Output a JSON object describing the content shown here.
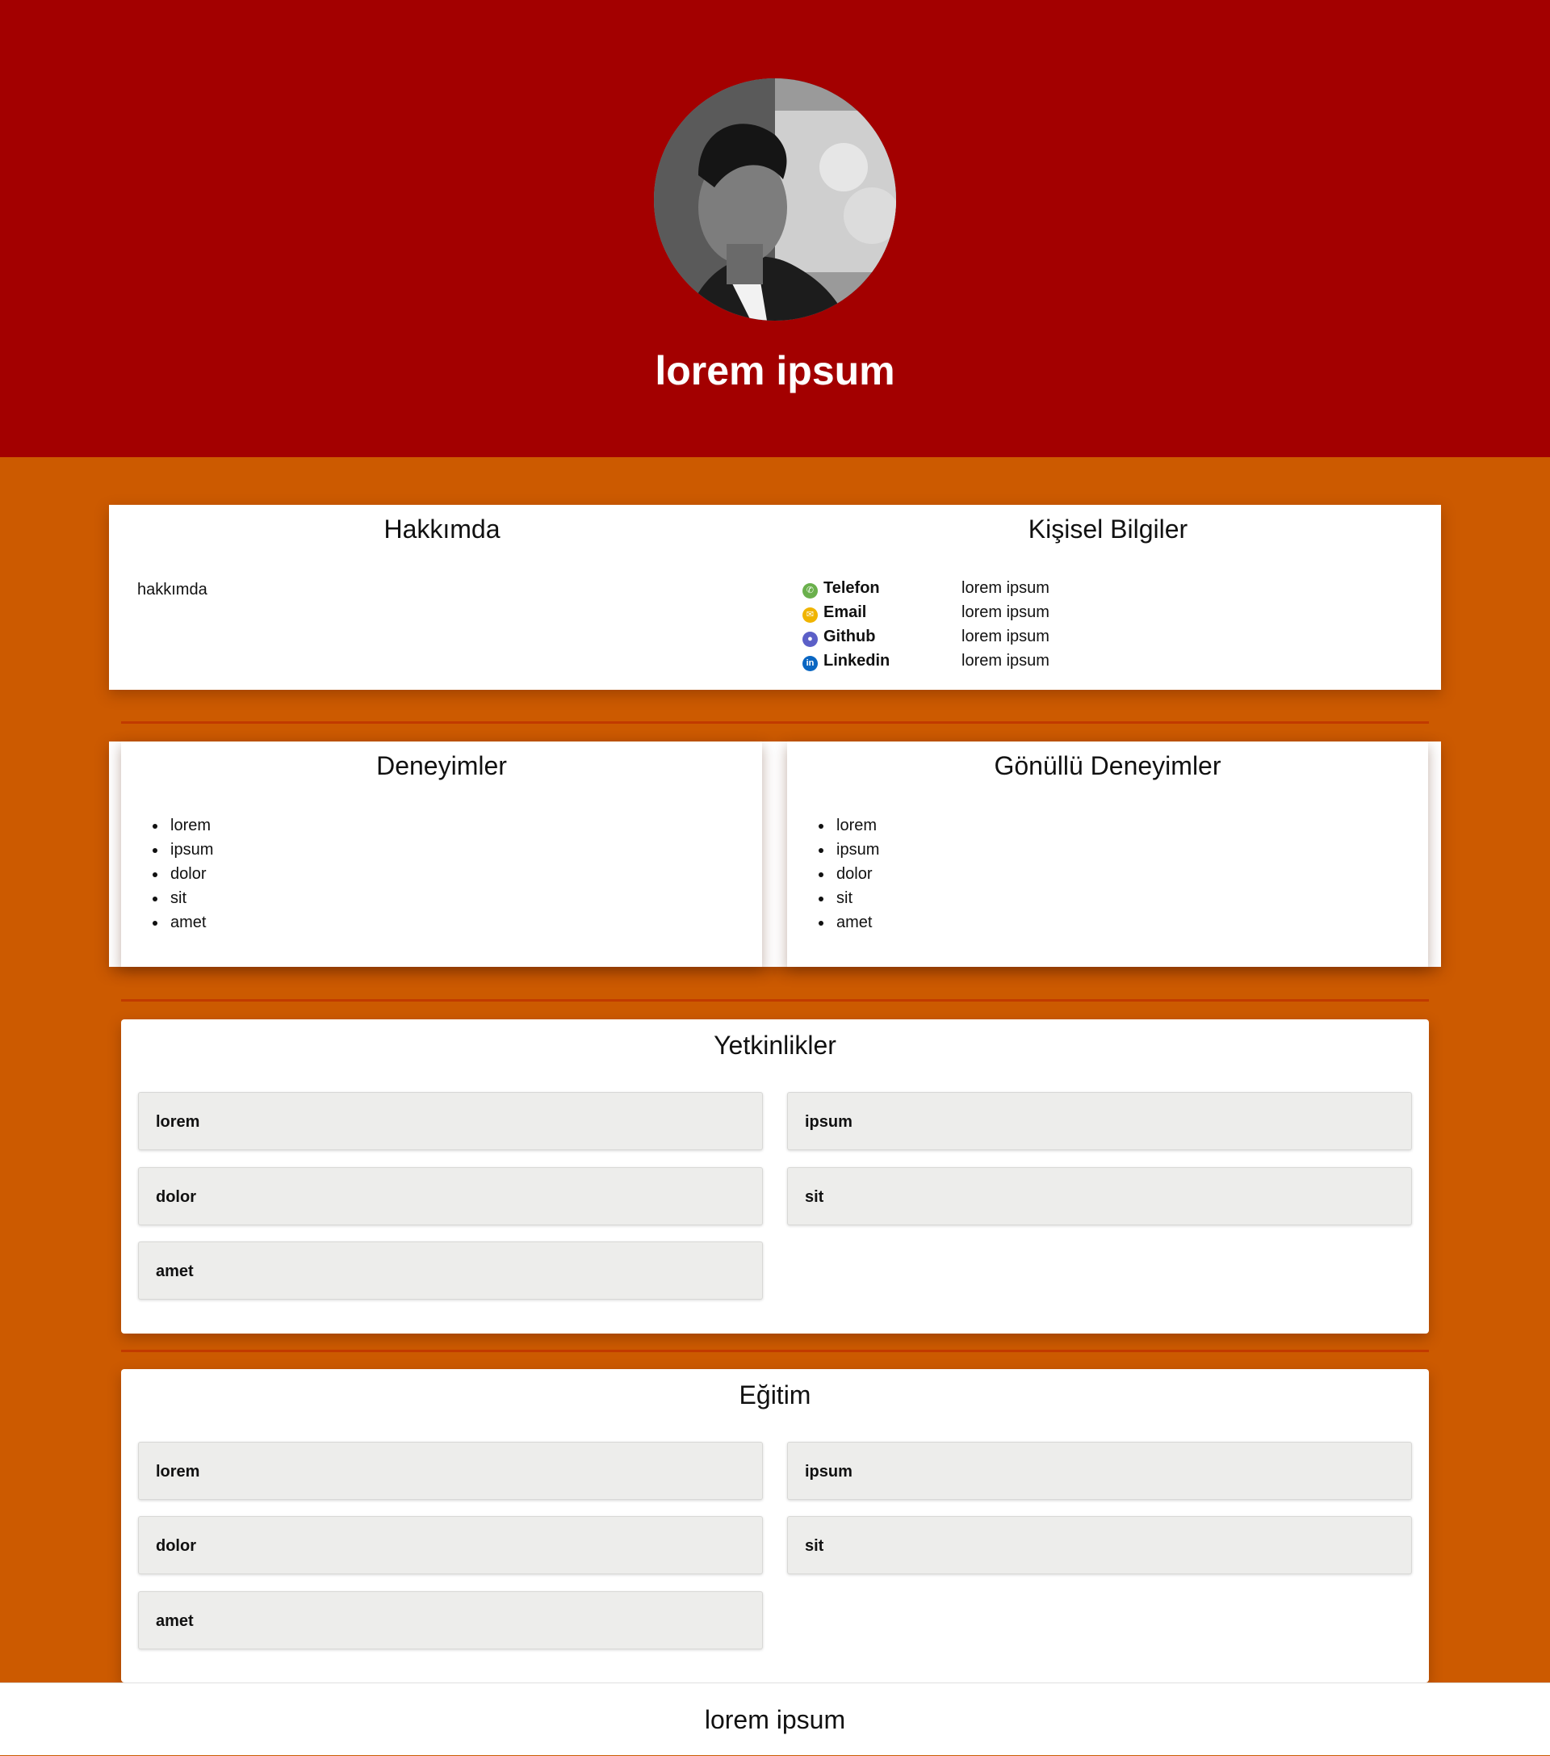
{
  "header": {
    "name": "lorem ipsum"
  },
  "about": {
    "title": "Hakkımda",
    "text": "hakkımda"
  },
  "personal": {
    "title": "Kişisel Bilgiler",
    "rows": [
      {
        "icon": "phone-icon",
        "label": "Telefon",
        "value": "lorem ipsum",
        "color": "#6ab04c"
      },
      {
        "icon": "email-icon",
        "label": "Email",
        "value": "lorem ipsum",
        "color": "#f0b400"
      },
      {
        "icon": "github-icon",
        "label": "Github",
        "value": "lorem ipsum",
        "color": "#5b5fc7"
      },
      {
        "icon": "linkedin-icon",
        "label": "Linkedin",
        "value": "lorem ipsum",
        "color": "#0a66c2"
      }
    ]
  },
  "experience": {
    "title": "Deneyimler",
    "items": [
      "lorem",
      "ipsum",
      "dolor",
      "sit",
      "amet"
    ]
  },
  "volunteer": {
    "title": "Gönüllü Deneyimler",
    "items": [
      "lorem",
      "ipsum",
      "dolor",
      "sit",
      "amet"
    ]
  },
  "skills": {
    "title": "Yetkinlikler",
    "items": [
      "lorem",
      "ipsum",
      "dolor",
      "sit",
      "amet"
    ]
  },
  "education": {
    "title": "Eğitim",
    "items": [
      "lorem",
      "ipsum",
      "dolor",
      "sit",
      "amet"
    ]
  },
  "footer": {
    "text": "lorem ipsum"
  },
  "colors": {
    "hero": "#a30000",
    "page": "#cc5a00",
    "divider": "#c13a00",
    "tile": "#ededeb"
  }
}
